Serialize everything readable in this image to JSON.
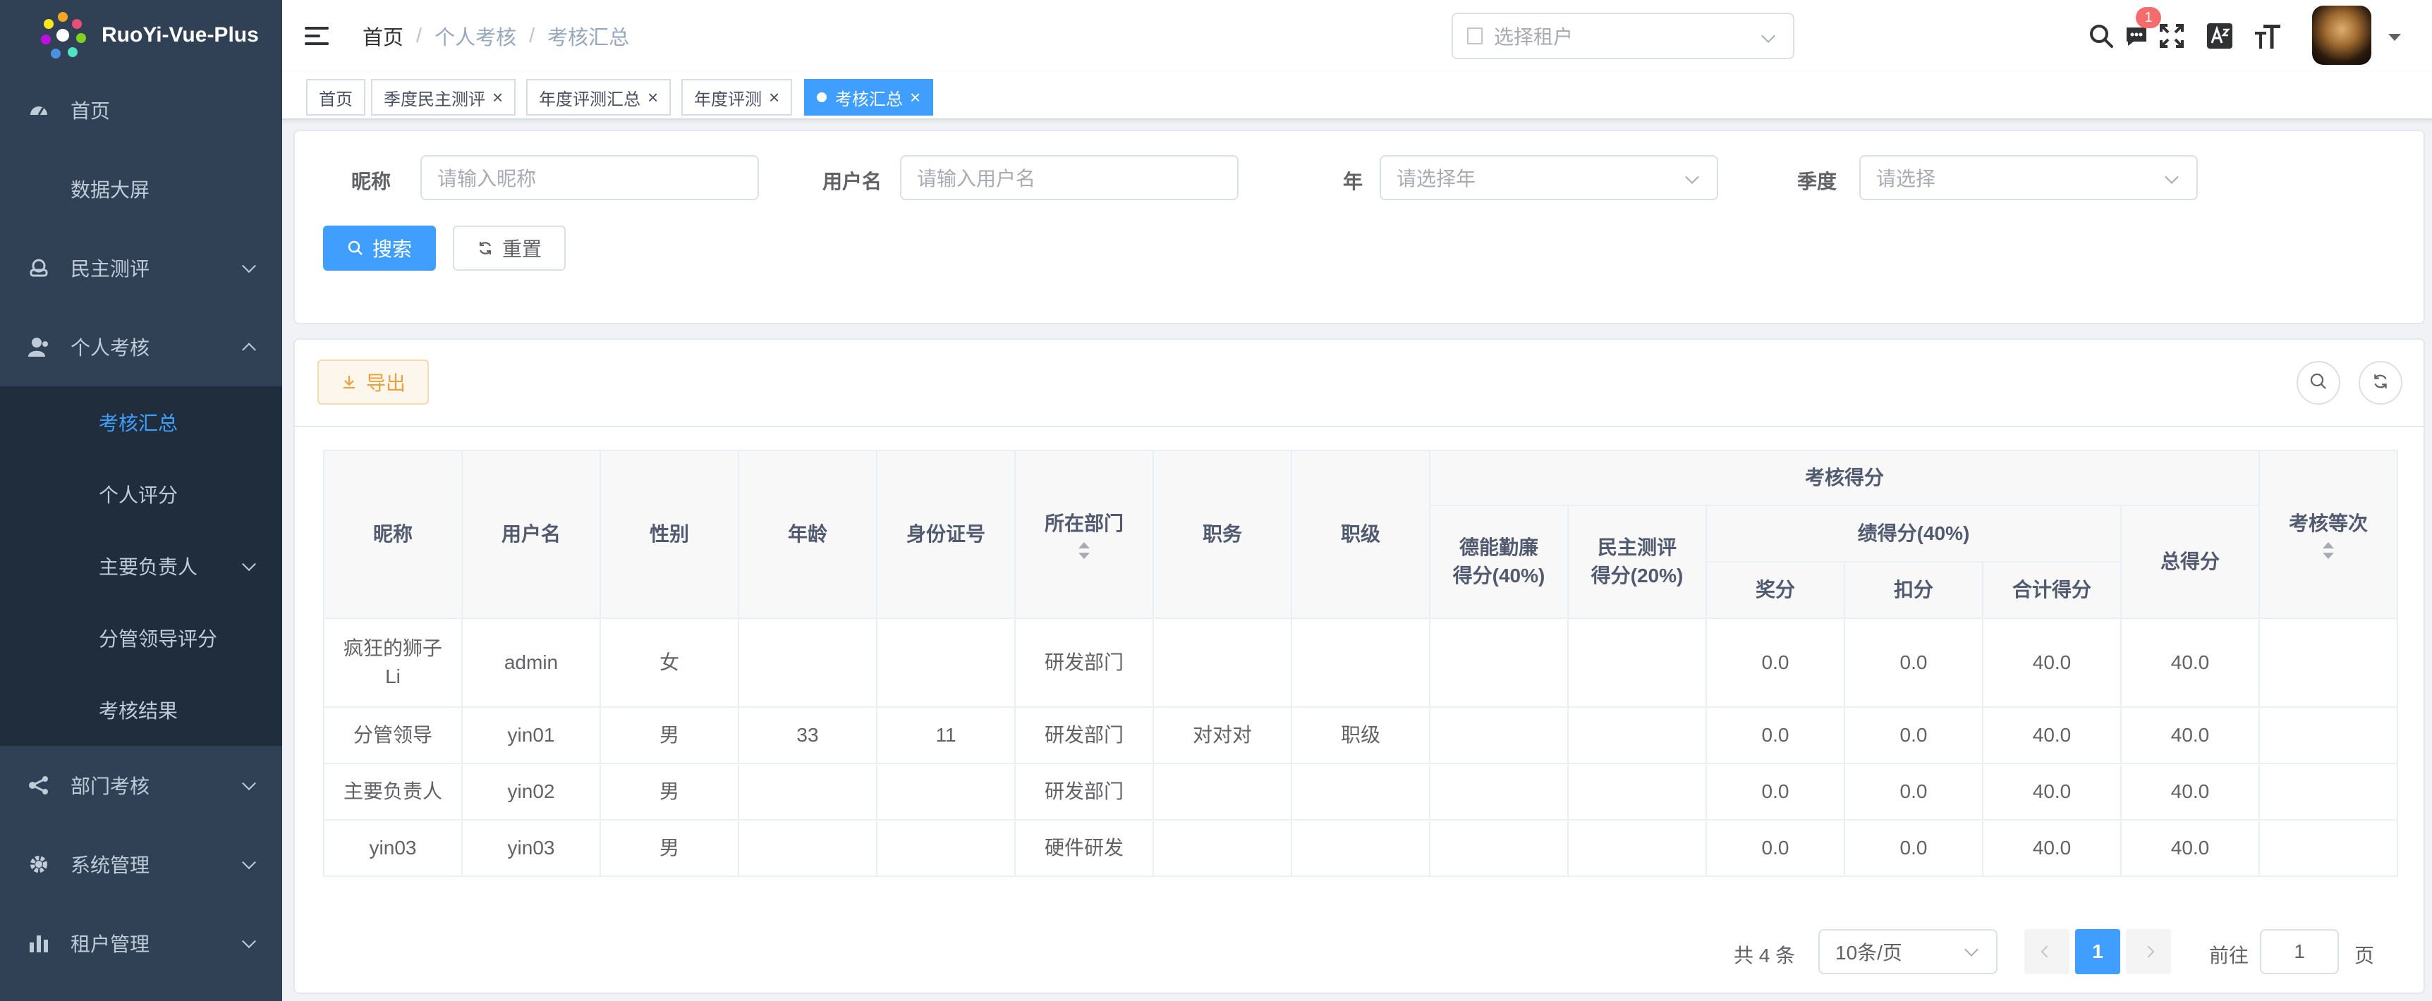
{
  "app": {
    "logo_text": "RuoYi-Vue-Plus"
  },
  "sidebar": {
    "items": [
      {
        "label": "首页",
        "icon": "dashboard-icon"
      },
      {
        "label": "数据大屏"
      },
      {
        "label": "民主测评",
        "icon": "peoples-icon"
      },
      {
        "label": "个人考核",
        "icon": "user-icon",
        "expanded": true,
        "children": [
          {
            "label": "考核汇总",
            "active": true
          },
          {
            "label": "个人评分"
          },
          {
            "label": "主要负责人"
          },
          {
            "label": "分管领导评分"
          },
          {
            "label": "考核结果"
          }
        ]
      },
      {
        "label": "部门考核",
        "icon": "tree-icon"
      },
      {
        "label": "系统管理",
        "icon": "gear-icon"
      },
      {
        "label": "租户管理",
        "icon": "chart-icon"
      }
    ]
  },
  "header": {
    "breadcrumb": [
      "首页",
      "个人考核",
      "考核汇总"
    ],
    "breadcrumb_sep": "/",
    "tenant_placeholder": "选择租户",
    "message_badge": "1"
  },
  "tags": [
    {
      "label": "首页"
    },
    {
      "label": "季度民主测评"
    },
    {
      "label": "年度评测汇总"
    },
    {
      "label": "年度评测"
    },
    {
      "label": "考核汇总",
      "active": true
    }
  ],
  "search": {
    "nickname_label": "昵称",
    "nickname_placeholder": "请输入昵称",
    "username_label": "用户名",
    "username_placeholder": "请输入用户名",
    "year_label": "年",
    "year_placeholder": "请选择年",
    "quarter_label": "季度",
    "quarter_placeholder": "请选择",
    "search_btn": "搜索",
    "reset_btn": "重置"
  },
  "toolbar": {
    "export_btn": "导出"
  },
  "table": {
    "headers": {
      "nickname": "昵称",
      "username": "用户名",
      "gender": "性别",
      "age": "年龄",
      "idcard": "身份证号",
      "dept": "所在部门",
      "post": "职务",
      "rank": "职级",
      "score_group": "考核得分",
      "moral": "德能勤廉得分(40%)",
      "demo": "民主测评得分(20%)",
      "perf_group": "绩得分(40%)",
      "bonus": "奖分",
      "deduct": "扣分",
      "perf_total": "合计得分",
      "total": "总得分",
      "grade": "考核等次"
    },
    "rows": [
      {
        "nickname": "疯狂的狮子Li",
        "username": "admin",
        "gender": "女",
        "age": "",
        "idcard": "",
        "dept": "研发部门",
        "post": "",
        "rank": "",
        "moral": "",
        "demo": "",
        "bonus": "0.0",
        "deduct": "0.0",
        "perf_total": "40.0",
        "total": "40.0",
        "grade": ""
      },
      {
        "nickname": "分管领导",
        "username": "yin01",
        "gender": "男",
        "age": "33",
        "idcard": "11",
        "dept": "研发部门",
        "post": "对对对",
        "rank": "职级",
        "moral": "",
        "demo": "",
        "bonus": "0.0",
        "deduct": "0.0",
        "perf_total": "40.0",
        "total": "40.0",
        "grade": ""
      },
      {
        "nickname": "主要负责人",
        "username": "yin02",
        "gender": "男",
        "age": "",
        "idcard": "",
        "dept": "研发部门",
        "post": "",
        "rank": "",
        "moral": "",
        "demo": "",
        "bonus": "0.0",
        "deduct": "0.0",
        "perf_total": "40.0",
        "total": "40.0",
        "grade": ""
      },
      {
        "nickname": "yin03",
        "username": "yin03",
        "gender": "男",
        "age": "",
        "idcard": "",
        "dept": "硬件研发",
        "post": "",
        "rank": "",
        "moral": "",
        "demo": "",
        "bonus": "0.0",
        "deduct": "0.0",
        "perf_total": "40.0",
        "total": "40.0",
        "grade": ""
      }
    ]
  },
  "pagination": {
    "total_text": "共 4 条",
    "page_size": "10条/页",
    "current_page": "1",
    "goto_label": "前往",
    "goto_value": "1",
    "page_unit": "页"
  },
  "colors": {
    "primary": "#409eff",
    "sidebar_bg": "#304156",
    "submenu_bg": "#1f2d3d",
    "warning": "#e6a23c",
    "danger": "#f56c6c"
  }
}
